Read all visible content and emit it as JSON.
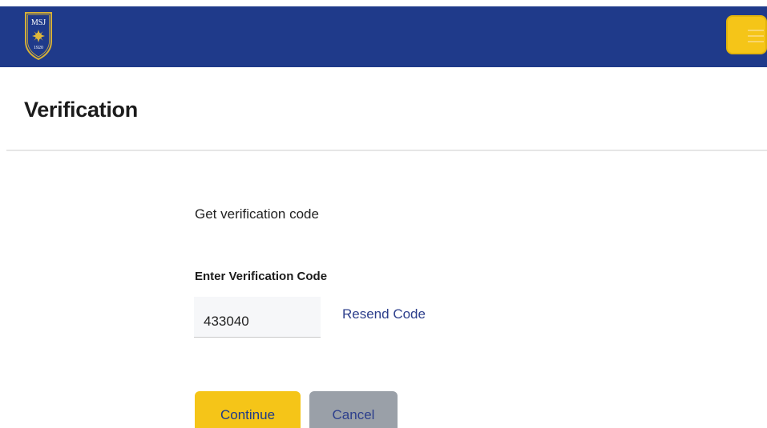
{
  "header": {
    "logo": {
      "text": "MSJ",
      "year": "1920",
      "colors": {
        "shield": "#1f3a8a",
        "border": "#d4af37",
        "emblem": "#e0b83a"
      }
    },
    "menu_button": {
      "icon": "hamburger-menu-icon",
      "color": "#f5c518"
    },
    "bar_color": "#1f3a8a"
  },
  "page": {
    "title": "Verification"
  },
  "form": {
    "instruction": "Get verification code",
    "code_label": "Enter Verification Code",
    "code_value": "433040",
    "resend_label": "Resend Code",
    "continue_label": "Continue",
    "cancel_label": "Cancel"
  },
  "colors": {
    "primary": "#1f3a8a",
    "accent": "#f5c518",
    "muted_button": "#9aa0a8",
    "link": "#2d3f8c"
  }
}
